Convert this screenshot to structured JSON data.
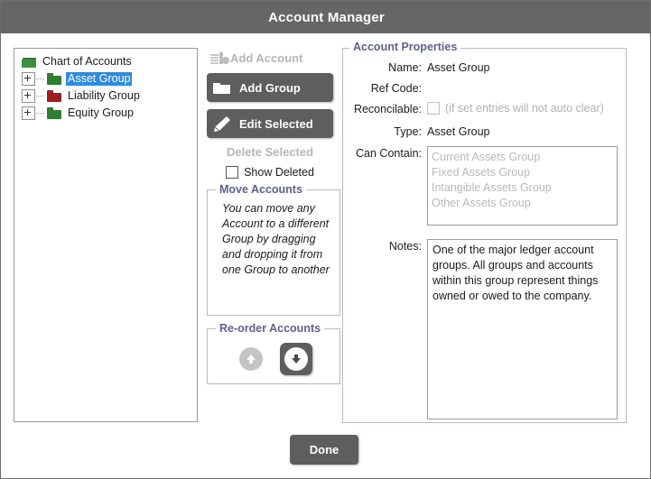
{
  "window": {
    "title": "Account Manager"
  },
  "tree": {
    "root": {
      "label": "Chart of Accounts",
      "icon": "open-folder-icon",
      "color": "#2f7d32"
    },
    "items": [
      {
        "label": "Asset Group",
        "icon": "folder-icon",
        "color": "#2f7d32",
        "selected": true
      },
      {
        "label": "Liability Group",
        "icon": "folder-icon",
        "color": "#9c1f22",
        "selected": false
      },
      {
        "label": "Equity Group",
        "icon": "folder-icon",
        "color": "#2f7d32",
        "selected": false
      }
    ]
  },
  "actions": {
    "add_account": {
      "label": "Add Account",
      "icon": "account-ledger-icon",
      "enabled": false
    },
    "add_group": {
      "label": "Add Group",
      "icon": "folder-icon",
      "enabled": true
    },
    "edit_selected": {
      "label": "Edit Selected",
      "icon": "pencil-icon",
      "enabled": true
    },
    "delete_selected": {
      "label": "Delete Selected",
      "enabled": false
    },
    "show_deleted": {
      "label": "Show Deleted",
      "checked": false
    }
  },
  "move_accounts": {
    "legend": "Move Accounts",
    "text": "You can move any Account to a different Group by dragging and dropping it from one Group to another"
  },
  "reorder_accounts": {
    "legend": "Re-order Accounts",
    "up": {
      "icon": "arrow-up-icon",
      "enabled": false
    },
    "down": {
      "icon": "arrow-down-icon",
      "enabled": true
    }
  },
  "properties": {
    "legend": "Account Properties",
    "name": {
      "label": "Name:",
      "value": "Asset Group"
    },
    "ref_code": {
      "label": "Ref Code:",
      "value": ""
    },
    "reconcilable": {
      "label": "Reconcilable:",
      "checked": false,
      "hint": "(if set entries will not auto clear)"
    },
    "type": {
      "label": "Type:",
      "value": "Asset Group"
    },
    "can_contain": {
      "label": "Can Contain:",
      "options": [
        "Current Assets Group",
        "Fixed Assets Group",
        "Intangible Assets Group",
        "Other Assets Group"
      ]
    },
    "notes": {
      "label": "Notes:",
      "value": "One of the major ledger account groups. All groups and accounts within this group represent things owned or owed to the company."
    }
  },
  "footer": {
    "done_label": "Done"
  },
  "colors": {
    "titlebar": "#666666",
    "button": "#5e5e5e",
    "legend": "#5f5f90",
    "selection": "#2f8ae0",
    "asset_folder": "#2f7d32",
    "liability_folder": "#9c1f22",
    "disabled_text": "#b6b6b6"
  }
}
